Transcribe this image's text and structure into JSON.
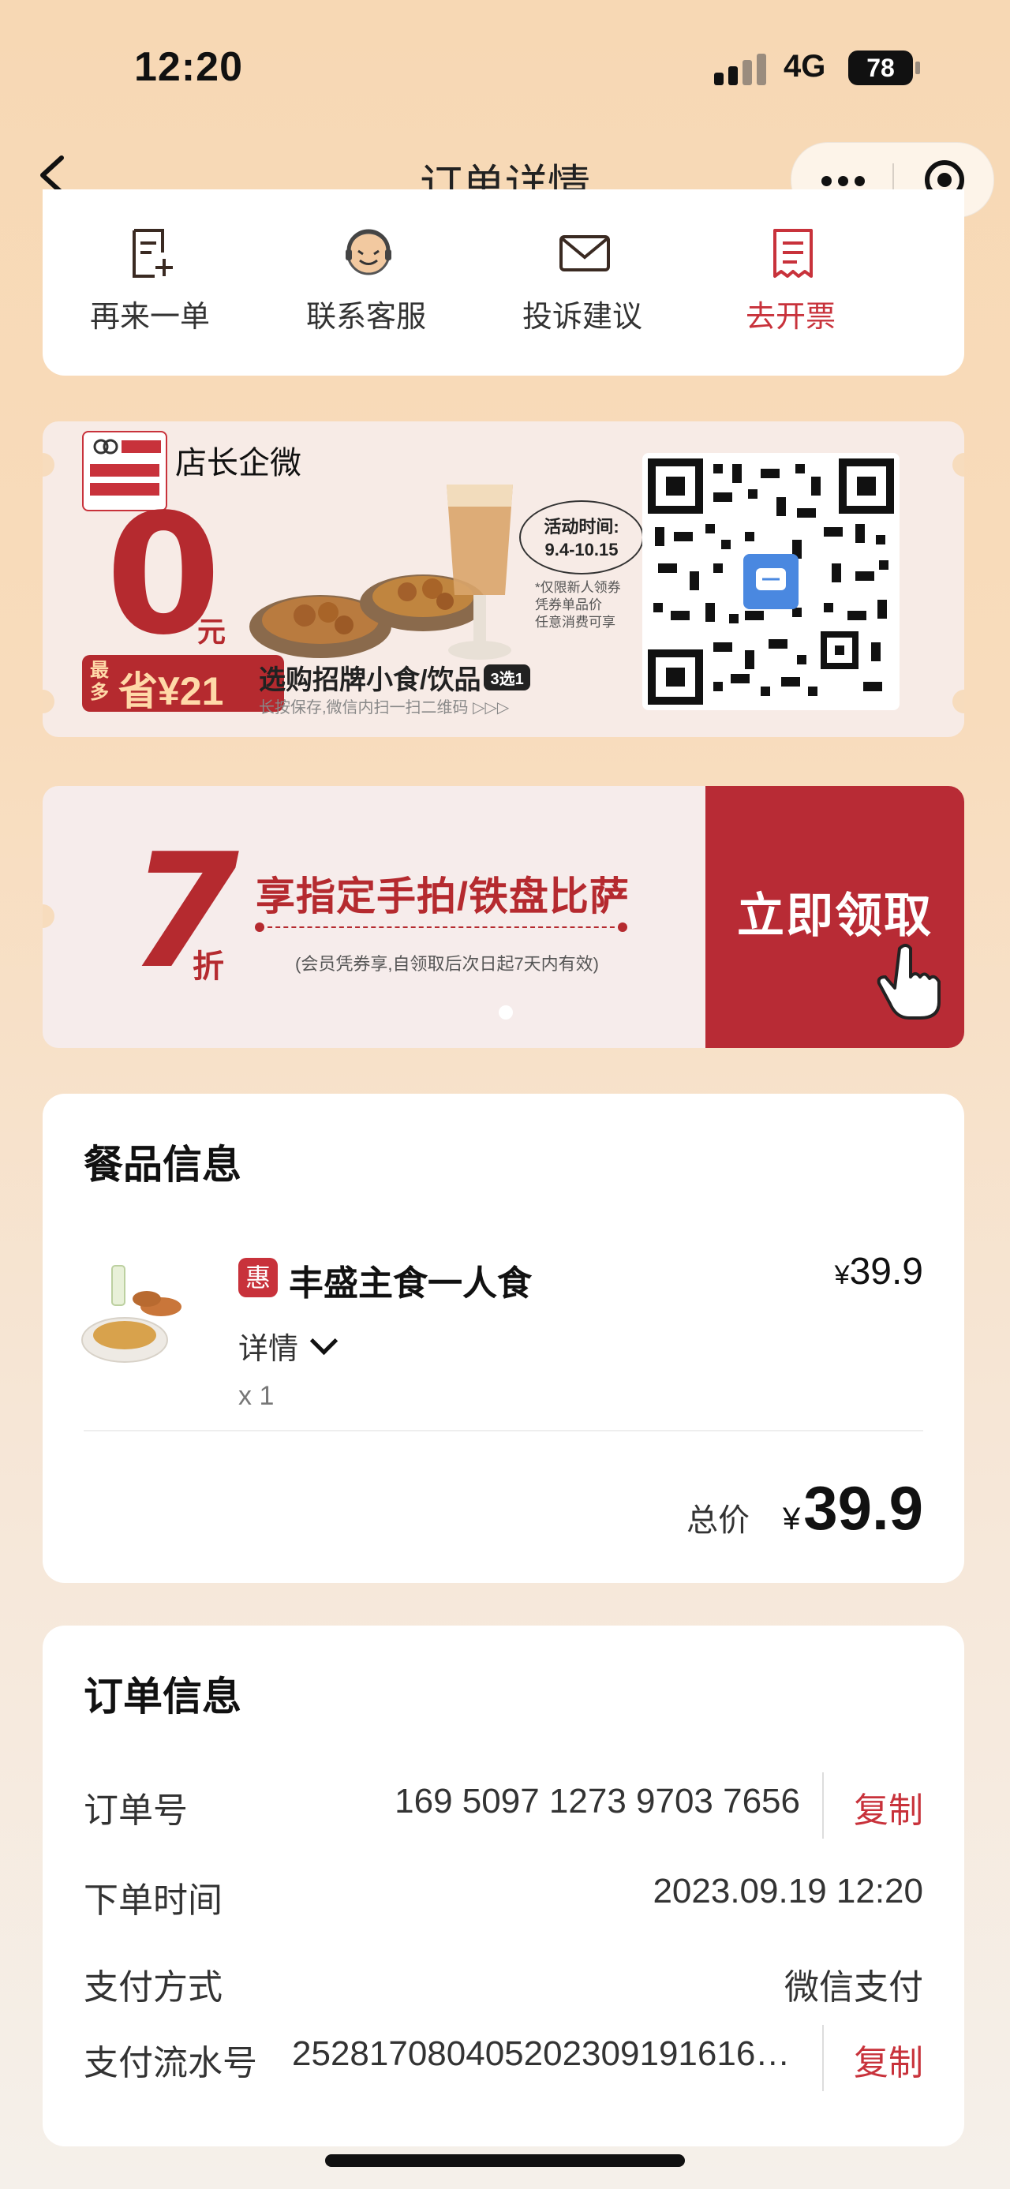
{
  "status_bar": {
    "time": "12:20",
    "network": "4G",
    "battery": "78"
  },
  "nav": {
    "title": "订单详情"
  },
  "actions": [
    {
      "label": "再来一单",
      "icon": "reorder-icon",
      "color": "#333333"
    },
    {
      "label": "联系客服",
      "icon": "customer-service-icon",
      "color": "#333333"
    },
    {
      "label": "投诉建议",
      "icon": "mail-icon",
      "color": "#333333"
    },
    {
      "label": "去开票",
      "icon": "invoice-icon",
      "color": "#c8323b"
    }
  ],
  "banner1": {
    "title": "店长企微",
    "big_value": "0",
    "unit": "元",
    "save_small": "最多",
    "save_text": "省¥21",
    "activity_label": "活动时间:",
    "activity_dates": "9.4-10.15",
    "note_lines": [
      "*仅限新人领券",
      "凭券单品价",
      "任意消费可享"
    ],
    "desc": "选购招牌小食/饮品",
    "tag": "3选1",
    "hint": "长按保存,微信内扫一扫二维码 ▷▷▷"
  },
  "banner2": {
    "big_value": "7",
    "unit": "折",
    "title": "享指定手拍/铁盘比萨",
    "subtitle": "(会员凭券享,自领取后次日起7天内有效)",
    "button": "立即领取"
  },
  "food_info": {
    "title": "餐品信息",
    "item": {
      "badge": "惠",
      "name": "丰盛主食一人食",
      "currency": "¥",
      "price": "39.9",
      "detail_label": "详情",
      "quantity": "x 1"
    },
    "total_label": "总价",
    "total_currency": "¥",
    "total_value": "39.9"
  },
  "order_info": {
    "title": "订单信息",
    "order_no_label": "订单号",
    "order_no": "169 5097 1273 9703 7656",
    "copy_label": "复制",
    "time_label": "下单时间",
    "time_value": "2023.09.19 12:20",
    "pay_method_label": "支付方式",
    "pay_method": "微信支付",
    "serial_label": "支付流水号",
    "serial_value": "252817080405202309191616…"
  },
  "colors": {
    "accent": "#c8323b",
    "background": "#f7d8b4"
  }
}
